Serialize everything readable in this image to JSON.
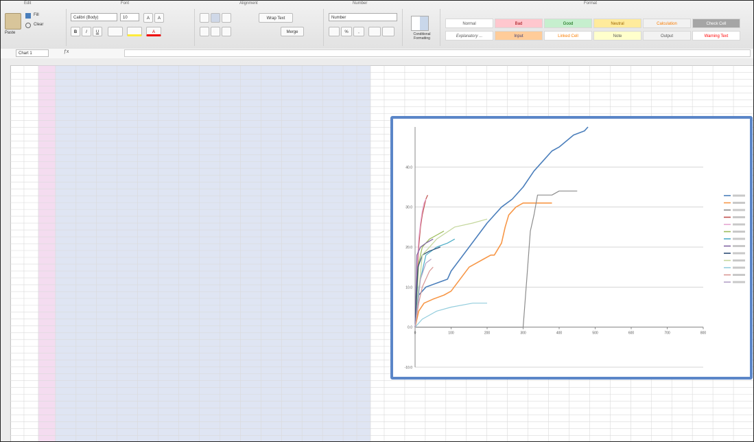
{
  "ribbon": {
    "groups": [
      "Edit",
      "Font",
      "Alignment",
      "Number",
      "Format"
    ],
    "paste_label": "Paste",
    "fill_label": "Fill",
    "clear_label": "Clear",
    "font_name": "Calibri (Body)",
    "font_size": "10",
    "wrap_text_label": "Wrap Text",
    "merge_label": "Merge",
    "number_format": "Number",
    "conditional_formatting_label": "Conditional Formatting",
    "styles": [
      "Normal",
      "Bad",
      "Good",
      "Neutral",
      "Calculation",
      "Check Cell",
      "Explanatory ...",
      "Input",
      "Linked Cell",
      "Note",
      "Output",
      "Warning Text"
    ]
  },
  "formula_bar": {
    "name_box": "Chart 1"
  },
  "colors": {
    "blue_col": "#dfe5f3",
    "pink_col": "#f4dcf0",
    "grid_line": "#dadada",
    "chart_border": "#5b86c8"
  },
  "chart_data": {
    "type": "line",
    "y_ticks": [
      "40.0",
      "30.0",
      "20.0",
      "10.0",
      "0.0",
      "-10.0"
    ],
    "x_ticks": [
      "0",
      "100",
      "200",
      "300",
      "400",
      "500",
      "600",
      "700",
      "800"
    ],
    "ylim": [
      -10,
      50
    ],
    "xlim": [
      0,
      800
    ],
    "legend_position": "right",
    "series": [
      {
        "color": "#4a7ebb",
        "points": [
          [
            0,
            0
          ],
          [
            10,
            8
          ],
          [
            30,
            10
          ],
          [
            60,
            11
          ],
          [
            90,
            12
          ],
          [
            100,
            14
          ],
          [
            150,
            20
          ],
          [
            200,
            26
          ],
          [
            240,
            30
          ],
          [
            270,
            32
          ],
          [
            300,
            35
          ],
          [
            330,
            39
          ],
          [
            360,
            42
          ],
          [
            380,
            44
          ],
          [
            400,
            45
          ],
          [
            440,
            48
          ],
          [
            470,
            49
          ],
          [
            480,
            50
          ]
        ]
      },
      {
        "color": "#f79646",
        "points": [
          [
            0,
            0
          ],
          [
            10,
            4
          ],
          [
            25,
            6
          ],
          [
            50,
            7
          ],
          [
            80,
            8
          ],
          [
            100,
            9
          ],
          [
            150,
            15
          ],
          [
            190,
            17
          ],
          [
            210,
            18
          ],
          [
            220,
            18
          ],
          [
            240,
            21
          ],
          [
            250,
            25
          ],
          [
            260,
            28
          ],
          [
            280,
            30
          ],
          [
            300,
            31
          ],
          [
            340,
            31
          ],
          [
            380,
            31
          ]
        ]
      },
      {
        "color": "#8c8c8c",
        "points": [
          [
            0,
            0
          ],
          [
            300,
            0
          ],
          [
            310,
            12
          ],
          [
            320,
            24
          ],
          [
            330,
            28
          ],
          [
            340,
            33
          ],
          [
            380,
            33
          ],
          [
            400,
            34
          ],
          [
            450,
            34
          ]
        ]
      },
      {
        "color": "#c0504d",
        "points": [
          [
            0,
            0
          ],
          [
            5,
            12
          ],
          [
            10,
            20
          ],
          [
            15,
            25
          ],
          [
            20,
            28
          ],
          [
            25,
            30
          ],
          [
            30,
            32
          ],
          [
            35,
            33
          ]
        ]
      },
      {
        "color": "#e6a6d0",
        "points": [
          [
            0,
            0
          ],
          [
            5,
            14
          ],
          [
            10,
            22
          ],
          [
            15,
            26
          ],
          [
            20,
            29
          ],
          [
            25,
            31
          ],
          [
            30,
            32
          ]
        ]
      },
      {
        "color": "#9bbb59",
        "points": [
          [
            0,
            0
          ],
          [
            10,
            16
          ],
          [
            20,
            20
          ],
          [
            40,
            22
          ],
          [
            60,
            23
          ],
          [
            80,
            24
          ]
        ]
      },
      {
        "color": "#4bacc6",
        "points": [
          [
            0,
            0
          ],
          [
            10,
            10
          ],
          [
            30,
            18
          ],
          [
            60,
            20
          ],
          [
            90,
            21
          ],
          [
            110,
            22
          ]
        ]
      },
      {
        "color": "#8064a2",
        "points": [
          [
            0,
            0
          ],
          [
            5,
            18
          ],
          [
            15,
            20
          ],
          [
            30,
            21
          ],
          [
            50,
            22
          ]
        ]
      },
      {
        "color": "#2c4d75",
        "points": [
          [
            0,
            0
          ],
          [
            8,
            15
          ],
          [
            20,
            18
          ],
          [
            40,
            19
          ],
          [
            70,
            20
          ]
        ]
      },
      {
        "color": "#c3d69b",
        "points": [
          [
            0,
            0
          ],
          [
            20,
            18
          ],
          [
            60,
            22
          ],
          [
            110,
            25
          ],
          [
            160,
            26
          ],
          [
            200,
            27
          ]
        ]
      },
      {
        "color": "#93cddd",
        "points": [
          [
            0,
            0
          ],
          [
            20,
            2
          ],
          [
            60,
            4
          ],
          [
            100,
            5
          ],
          [
            160,
            6
          ],
          [
            200,
            6
          ]
        ]
      },
      {
        "color": "#d99694",
        "points": [
          [
            0,
            0
          ],
          [
            10,
            6
          ],
          [
            20,
            10
          ],
          [
            40,
            14
          ],
          [
            50,
            15
          ]
        ]
      },
      {
        "color": "#b3a2c7",
        "points": [
          [
            0,
            0
          ],
          [
            15,
            12
          ],
          [
            30,
            16
          ],
          [
            45,
            17
          ]
        ]
      }
    ]
  }
}
